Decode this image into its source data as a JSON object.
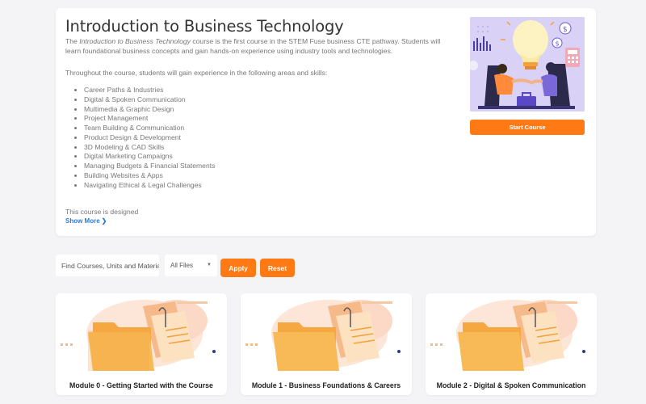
{
  "course": {
    "title": "Introduction to Business Technology",
    "description_italic": "Introduction to Business Technology",
    "description_prefix": "The ",
    "description_suffix": " course is the first course in the STEM Fuse business CTE pathway. Students will learn foundational business concepts and gain hands-on experience using industry tools and technologies.",
    "skills_intro": "Throughout the course, students will gain experience in the following areas and skills:",
    "skills": [
      "Career Paths & Industries",
      "Digital & Spoken Communication",
      "Multimedia & Graphic Design",
      "Project Management",
      "Team Building & Communication",
      "Product Design & Development",
      "3D Modeling & CAD Skills",
      "Digital Marketing Campaigns",
      "Managing Budgets & Financial Statements",
      "Building Websites & Apps",
      "Navigating Ethical & Legal Challenges"
    ],
    "truncated_text": "This course is designed",
    "show_more_label": "Show More",
    "start_label": "Start Course"
  },
  "filters": {
    "search_placeholder": "Find Courses, Units and Materials",
    "select_value": "All Files",
    "apply_label": "Apply",
    "reset_label": "Reset"
  },
  "modules": [
    {
      "title": "Module 0 - Getting Started with the Course"
    },
    {
      "title": "Module 1 - Business Foundations & Careers"
    },
    {
      "title": "Module 2 - Digital & Spoken Communication"
    }
  ],
  "colors": {
    "accent": "#ff7a14",
    "link": "#2e7bd6",
    "hero_bg": "#d9d2f6",
    "page_bg": "#f4f4f7"
  }
}
